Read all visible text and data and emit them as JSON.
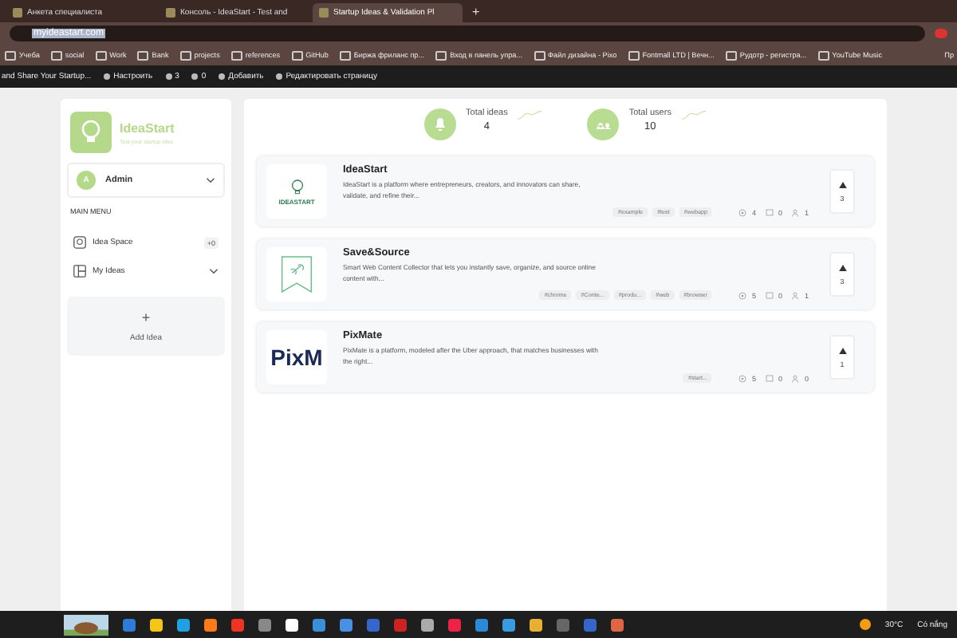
{
  "browser": {
    "tabs": [
      {
        "title": "Анкета специалиста",
        "selected": false
      },
      {
        "title": "Консоль - IdeaStart - Test and",
        "selected": false
      },
      {
        "title": "Startup Ideas & Validation Pl",
        "selected": true
      }
    ],
    "new_tab": "+",
    "url": "myideastart.com",
    "bookmarks": [
      "Учеба",
      "social",
      "Work",
      "Bank",
      "projects",
      "references",
      "GitHub",
      "Биржа фриланс пр...",
      "Вход в панель упра...",
      "Файл дизайна - Pixo",
      "Fontmall LTD | Вечн...",
      "Рудотр - регистра...",
      "YouTube Music"
    ],
    "more": "Пр",
    "admin_bar": [
      {
        "kind": "text",
        "label": "and Share Your Startup..."
      },
      {
        "kind": "brush",
        "label": "Настроить"
      },
      {
        "kind": "sync",
        "label": "3"
      },
      {
        "kind": "comment",
        "label": "0"
      },
      {
        "kind": "plus",
        "label": "Добавить"
      },
      {
        "kind": "pencil",
        "label": "Редактировать страницу"
      }
    ]
  },
  "sidebar": {
    "brand": "IdeaStart",
    "tagline": "Test your startup idea",
    "user": {
      "initial": "A",
      "name": "Admin"
    },
    "menu_heading": "MAIN MENU",
    "menu": [
      {
        "kind": "space",
        "label": "Idea Space",
        "badge": "+0"
      },
      {
        "kind": "ideas",
        "label": "My Ideas"
      }
    ],
    "add": {
      "icon": "+",
      "label": "Add Idea"
    }
  },
  "stats": [
    {
      "kind": "bell",
      "label": "Total ideas",
      "value": "4"
    },
    {
      "kind": "users",
      "label": "Total users",
      "value": "10"
    }
  ],
  "ideas": [
    {
      "title": "IdeaStart",
      "description": "IdeaStart is a platform where entrepreneurs, creators, and innovators can share, validate, and refine their...",
      "logo": {
        "kind": "bulb",
        "text": "IDEASTART"
      },
      "tags": [
        "#example",
        "#test",
        "#webapp"
      ],
      "views": "4",
      "comments": "0",
      "members": "1",
      "votes": "3"
    },
    {
      "title": "Save&Source",
      "description": "Smart Web Content Collector that lets you instantly save, organize, and source online content with...",
      "logo": {
        "kind": "bookmark"
      },
      "tags": [
        "#chrome",
        "#Conte...",
        "#produ...",
        "#web",
        "#browser"
      ],
      "views": "5",
      "comments": "0",
      "members": "1",
      "votes": "3"
    },
    {
      "title": "PixMate",
      "description": "PixMate is a platform, modeled after the Uber approach, that matches businesses with the right...",
      "logo": {
        "kind": "wordmark",
        "text": "PixM"
      },
      "tags": [
        "#start..."
      ],
      "views": "5",
      "comments": "0",
      "members": "0",
      "votes": "1"
    }
  ],
  "taskbar": {
    "temperature": "30°C",
    "weather": "Có nắng"
  }
}
